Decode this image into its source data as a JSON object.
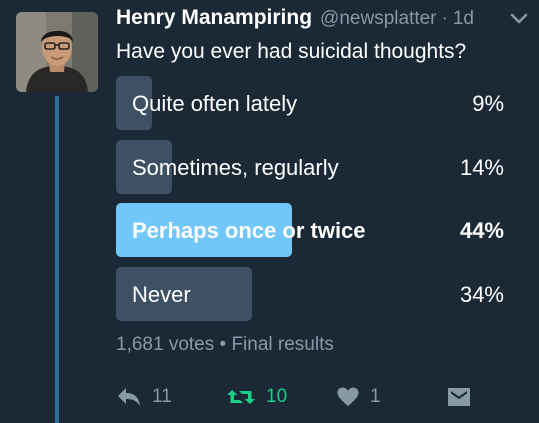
{
  "tweet": {
    "author_name": "Henry Manampiring",
    "author_handle": "@newsplatter",
    "separator": "·",
    "timestamp": "1d",
    "text": "Have you ever had suicidal thoughts?"
  },
  "poll": {
    "choices": [
      {
        "label": "Quite often lately",
        "percent_text": "9%",
        "percent": 9,
        "selected": false
      },
      {
        "label": "Sometimes, regularly",
        "percent_text": "14%",
        "percent": 14,
        "selected": false
      },
      {
        "label": "Perhaps once or twice",
        "percent_text": "44%",
        "percent": 44,
        "selected": true
      },
      {
        "label": "Never",
        "percent_text": "34%",
        "percent": 34,
        "selected": false
      }
    ],
    "summary": "1,681 votes • Final results"
  },
  "actions": {
    "reply_count": "11",
    "retweet_count": "10",
    "like_count": "1",
    "reply_icon": "reply-icon",
    "retweet_icon": "retweet-icon",
    "like_icon": "heart-icon",
    "dm_icon": "direct-message-icon",
    "menu_icon": "chevron-down-icon"
  },
  "colors": {
    "background": "#1b2836",
    "bar": "#3e5064",
    "bar_selected": "#71c6fa",
    "muted_text": "#8899a6",
    "retweet_active": "#19cf86",
    "thread_line": "#2e6f97"
  }
}
